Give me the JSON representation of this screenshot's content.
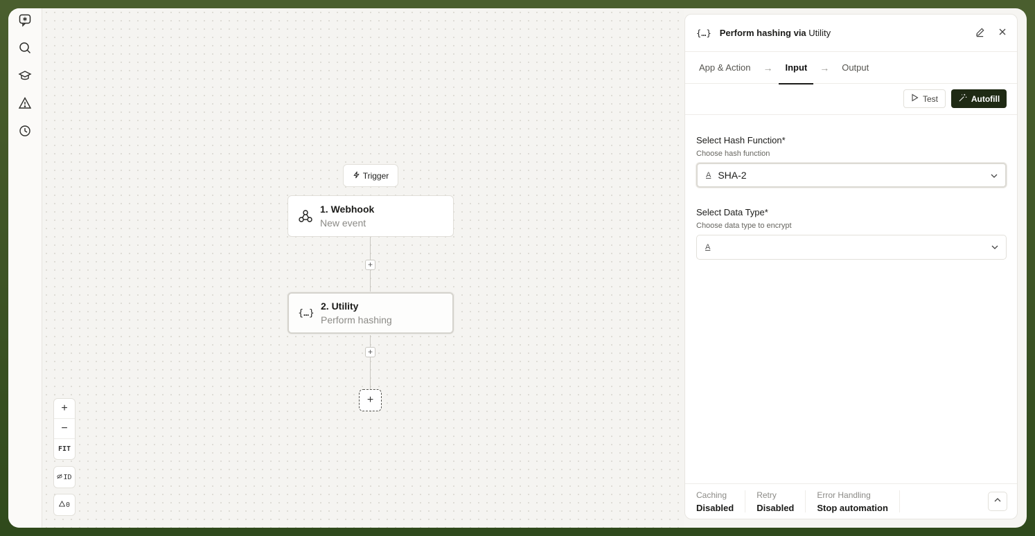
{
  "rail": {
    "icons": [
      "chat-star-icon",
      "search-icon",
      "graduation-cap-icon",
      "warning-icon",
      "history-icon"
    ]
  },
  "canvas": {
    "trigger_label": "Trigger",
    "nodes": [
      {
        "title": "1. Webhook",
        "subtitle": "New event",
        "icon": "webhook-icon"
      },
      {
        "title": "2. Utility",
        "subtitle": "Perform hashing",
        "icon": "braces-icon",
        "icon_text": "{…}"
      }
    ],
    "zoom": {
      "in": "+",
      "out": "−",
      "fit": "FIT"
    },
    "id_toggle": "ID",
    "warnings": "0"
  },
  "panel": {
    "icon_text": "{…}",
    "title_action": "Perform hashing via",
    "title_app": "Utility",
    "tabs": [
      {
        "label": "App & Action",
        "active": false
      },
      {
        "label": "Input",
        "active": true
      },
      {
        "label": "Output",
        "active": false
      }
    ],
    "test_label": "Test",
    "autofill_label": "Autofill",
    "fields": [
      {
        "label": "Select Hash Function*",
        "hint": "Choose hash function",
        "value": "SHA-2"
      },
      {
        "label": "Select Data Type*",
        "hint": "Choose data type to encrypt",
        "value": ""
      }
    ],
    "footer": [
      {
        "label": "Caching",
        "value": "Disabled"
      },
      {
        "label": "Retry",
        "value": "Disabled"
      },
      {
        "label": "Error Handling",
        "value": "Stop automation"
      }
    ]
  }
}
